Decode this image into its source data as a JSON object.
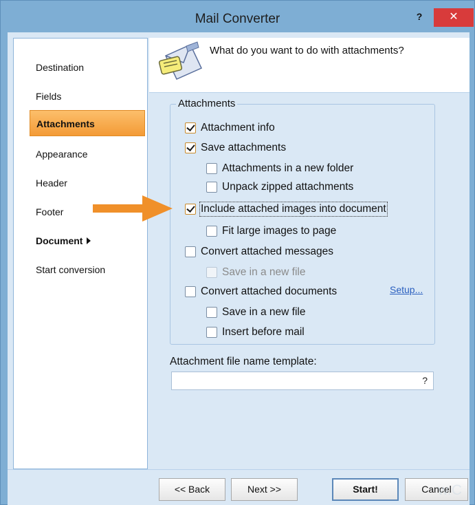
{
  "window": {
    "title": "Mail Converter",
    "help_label": "?",
    "close_label": "✕"
  },
  "sidebar": {
    "items": [
      {
        "label": "Destination"
      },
      {
        "label": "Fields"
      },
      {
        "label": "Attachments",
        "active": true
      },
      {
        "label": "Appearance"
      },
      {
        "label": "Header"
      },
      {
        "label": "Footer"
      },
      {
        "label": "Document",
        "bold": true,
        "submenu": true
      },
      {
        "label": "Start conversion"
      }
    ]
  },
  "header": {
    "question": "What do you want to do with attachments?",
    "icon": "envelope-with-note-icon"
  },
  "attachments_group": {
    "legend": "Attachments",
    "options": [
      {
        "label": "Attachment info",
        "checked": true,
        "enabled": true
      },
      {
        "label": "Save attachments",
        "checked": true,
        "enabled": true
      },
      {
        "label": "Attachments in a new folder",
        "checked": false,
        "enabled": true
      },
      {
        "label": "Unpack zipped attachments",
        "checked": false,
        "enabled": true
      },
      {
        "label": "Include attached images into document",
        "checked": true,
        "enabled": true,
        "focused": true
      },
      {
        "label": "Fit large images to page",
        "checked": false,
        "enabled": true
      },
      {
        "label": "Convert attached messages",
        "checked": false,
        "enabled": true
      },
      {
        "label": "Save in a new file",
        "checked": false,
        "enabled": false
      },
      {
        "label": "Convert attached documents",
        "checked": false,
        "enabled": true
      },
      {
        "label": "Save in a new file",
        "checked": false,
        "enabled": true
      },
      {
        "label": "Insert before mail",
        "checked": false,
        "enabled": true
      }
    ],
    "setup_link": "Setup..."
  },
  "template": {
    "label": "Attachment file name template:",
    "value": "",
    "help": "?"
  },
  "buttons": {
    "back": "<< Back",
    "next": "Next >>",
    "start": "Start!",
    "cancel": "Cancel"
  },
  "watermark": "w.C",
  "colors": {
    "accent": "#f39b36",
    "frame": "#7eaed4",
    "close": "#d83b3b",
    "arrow": "#f0902a"
  }
}
